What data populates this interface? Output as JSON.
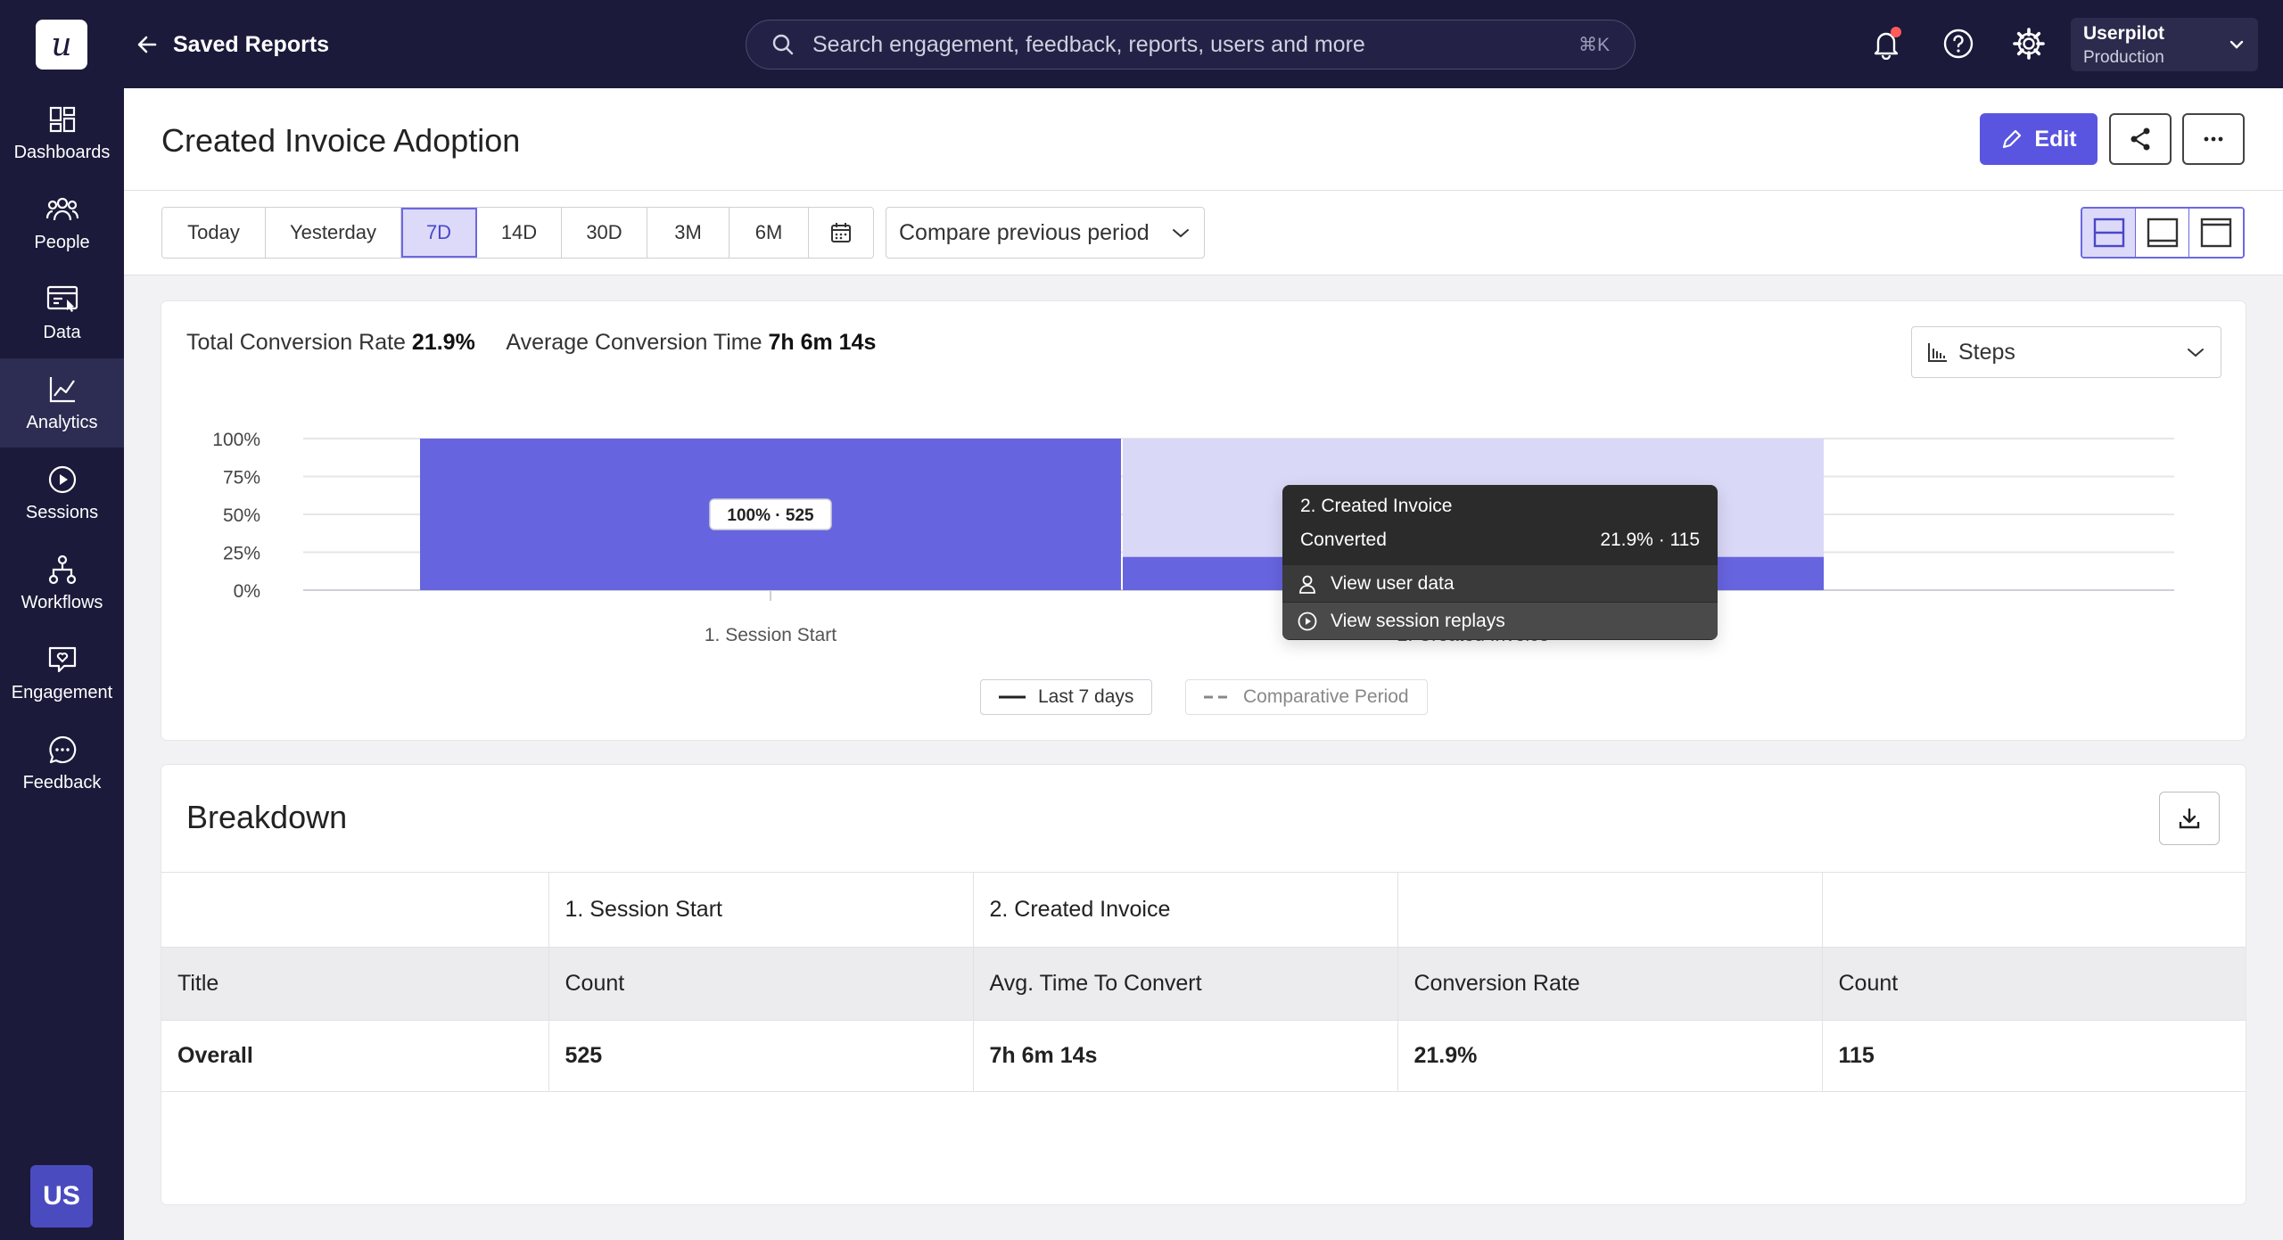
{
  "topbar": {
    "logo_letter": "u",
    "back_label": "Saved Reports",
    "search_placeholder": "Search engagement, feedback, reports, users and more",
    "search_shortcut": "⌘K",
    "workspace_name": "Userpilot",
    "workspace_env": "Production"
  },
  "sidebar": {
    "items": [
      {
        "label": "Dashboards",
        "icon": "dashboard-icon"
      },
      {
        "label": "People",
        "icon": "people-icon"
      },
      {
        "label": "Data",
        "icon": "data-icon"
      },
      {
        "label": "Analytics",
        "icon": "analytics-icon",
        "active": true
      },
      {
        "label": "Sessions",
        "icon": "play-icon"
      },
      {
        "label": "Workflows",
        "icon": "workflow-icon"
      },
      {
        "label": "Engagement",
        "icon": "engagement-icon"
      },
      {
        "label": "Feedback",
        "icon": "feedback-icon"
      }
    ],
    "avatar": "US"
  },
  "header": {
    "title": "Created Invoice Adoption",
    "edit_label": "Edit"
  },
  "filters": {
    "ranges": [
      "Today",
      "Yesterday",
      "7D",
      "14D",
      "30D",
      "3M",
      "6M"
    ],
    "selected": "7D",
    "compare_label": "Compare previous period"
  },
  "summary": {
    "rate_label": "Total Conversion Rate",
    "rate_value": "21.9%",
    "time_label": "Average Conversion Time",
    "time_value": "7h 6m 14s",
    "view_select": "Steps"
  },
  "chart_data": {
    "type": "bar",
    "categories": [
      "1. Session Start",
      "2. Created Invoice"
    ],
    "values": [
      100,
      21.9
    ],
    "counts": [
      525,
      115
    ],
    "data_labels": [
      "100% · 525",
      "21.9% · 115"
    ],
    "y_ticks": [
      "100%",
      "75%",
      "50%",
      "25%",
      "0%"
    ],
    "ylim": [
      0,
      100
    ],
    "colors": {
      "primary": "#6764e0",
      "background": "#d9d8f6"
    },
    "legend": [
      "Last 7 days",
      "Comparative Period"
    ]
  },
  "tooltip": {
    "title": "2. Created Invoice",
    "row_label": "Converted",
    "row_value": "21.9% · 115",
    "action_user": "View user data",
    "action_replays": "View session replays"
  },
  "breakdown": {
    "title": "Breakdown",
    "step_headers": [
      "",
      "1. Session Start",
      "2. Created Invoice",
      "",
      ""
    ],
    "columns": [
      "Title",
      "Count",
      "Avg. Time To Convert",
      "Conversion Rate",
      "Count"
    ],
    "rows": [
      [
        "Overall",
        "525",
        "7h 6m 14s",
        "21.9%",
        "115"
      ]
    ]
  }
}
